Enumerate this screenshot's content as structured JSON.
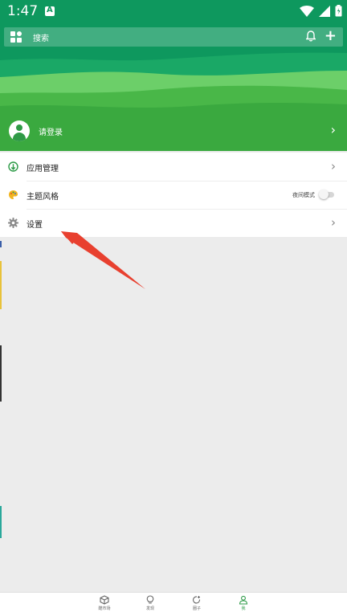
{
  "status_bar": {
    "time": "1:47"
  },
  "search": {
    "placeholder": "搜索"
  },
  "profile": {
    "login_text": "请登录"
  },
  "menu": {
    "items": [
      {
        "label": "应用管理"
      },
      {
        "label": "主题风格",
        "toggle_label": "夜间模式",
        "toggle_on": false
      },
      {
        "label": "设置"
      }
    ]
  },
  "bottom_nav": {
    "tabs": [
      {
        "label": "酷市场",
        "active": false
      },
      {
        "label": "发现",
        "active": false
      },
      {
        "label": "圈子",
        "active": false
      },
      {
        "label": "我",
        "active": true
      }
    ]
  },
  "colors": {
    "header_dark": "#0f9a5f",
    "header_light": "#4fbf52",
    "accent": "#2e9b48",
    "annotation_arrow": "#e8402f"
  }
}
